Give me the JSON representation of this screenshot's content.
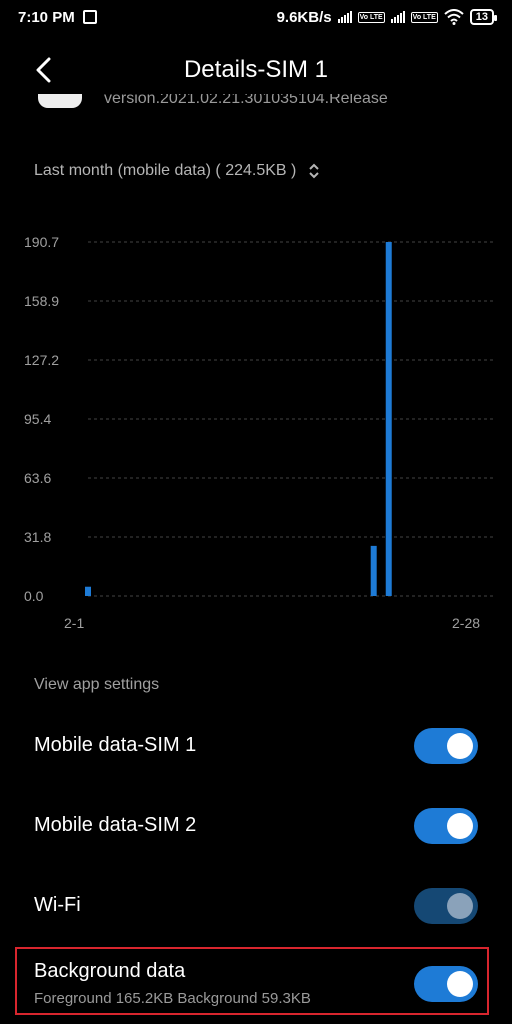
{
  "status_bar": {
    "time": "7:10 PM",
    "net_speed": "9.6KB/s",
    "volte1": "Vo LTE",
    "volte2": "Vo LTE",
    "battery": "13"
  },
  "header": {
    "title": "Details-SIM 1"
  },
  "app_info": {
    "version": "version.2021.02.21.301035104.Release"
  },
  "range": {
    "label": "Last month (mobile data) ( 224.5KB )"
  },
  "chart_data": {
    "type": "bar",
    "yticks": [
      "190.7",
      "158.9",
      "127.2",
      "95.4",
      "63.6",
      "31.8",
      "0.0"
    ],
    "ylim": [
      0,
      190.7
    ],
    "x_start_label": "2-1",
    "x_end_label": "2-28",
    "x_start": 1,
    "x_end": 28,
    "bars": [
      {
        "day": 1,
        "value": 5
      },
      {
        "day": 20,
        "value": 27
      },
      {
        "day": 21,
        "value": 190.7
      }
    ],
    "grid": true,
    "bar_color": "#1e7bd6"
  },
  "settings": {
    "section_label": "View app settings",
    "mobile_sim1": {
      "label": "Mobile data-SIM 1",
      "on": true
    },
    "mobile_sim2": {
      "label": "Mobile data-SIM 2",
      "on": true
    },
    "wifi": {
      "label": "Wi-Fi",
      "on": true
    },
    "background": {
      "label": "Background data",
      "sub": "Foreground 165.2KB  Background 59.3KB",
      "on": true
    }
  },
  "colors": {
    "accent": "#1e7bd6",
    "highlight_border": "#d8262e"
  }
}
